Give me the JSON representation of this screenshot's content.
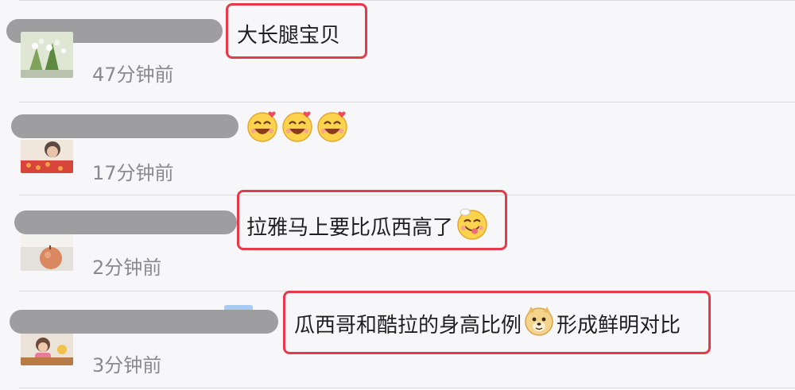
{
  "comments": [
    {
      "text": "大长腿宝贝",
      "time": "47分钟前",
      "highlighted": true
    },
    {
      "text": "",
      "time": "17分钟前",
      "highlighted": false,
      "emojis": [
        "laugh-heart-emoji",
        "laugh-heart-emoji",
        "laugh-heart-emoji"
      ]
    },
    {
      "text_before": "拉雅马上要比瓜西高了",
      "time": "2分钟前",
      "highlighted": true,
      "emoji": "tongue-smile-emoji"
    },
    {
      "text_before": "瓜西哥和酷拉的身高比例",
      "emoji": "doge-emoji",
      "text_after": "形成鲜明对比",
      "time": "3分钟前",
      "highlighted": true
    }
  ],
  "colors": {
    "highlight": "#e6394b",
    "redaction": "#9e9ea1",
    "time": "#8a8a8e",
    "background": "#f7f7f9"
  }
}
